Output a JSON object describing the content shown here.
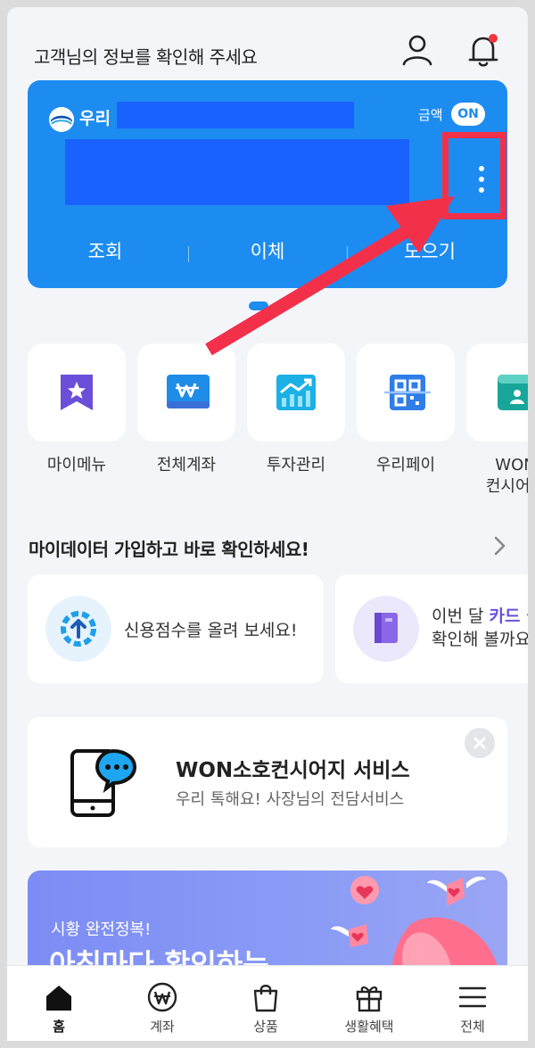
{
  "header": {
    "greeting": "고객님의 정보를 확인해 주세요"
  },
  "account_card": {
    "bank_name": "우리",
    "amount_label": "금액",
    "amount_toggle": "ON",
    "actions": [
      "조회",
      "이체",
      "모으기"
    ]
  },
  "quick_menu": [
    {
      "label": "마이메뉴",
      "icon": "star-bookmark-icon"
    },
    {
      "label": "전체계좌",
      "icon": "won-wallet-icon"
    },
    {
      "label": "투자관리",
      "icon": "chart-up-icon"
    },
    {
      "label": "우리페이",
      "icon": "qr-scan-icon"
    },
    {
      "label": "WON\n컨시어지",
      "icon": "concierge-card-icon"
    }
  ],
  "mydata": {
    "title": "마이데이터 가입하고 바로 확인하세요!",
    "cards": [
      {
        "text": "신용점수를 올려 보세요!"
      },
      {
        "line1_prefix": "이번 달 ",
        "line1_highlight": "카드 실",
        "line2": "확인해 볼까요"
      }
    ]
  },
  "promo": {
    "title": "WON소호컨시어지 서비스",
    "subtitle": "우리 톡해요! 사장님의 전담서비스"
  },
  "banner": {
    "subtitle": "시황 완전정복!",
    "title": "아침마다 확인하는"
  },
  "bottom_nav": [
    {
      "label": "홈",
      "icon": "home-icon",
      "active": true
    },
    {
      "label": "계좌",
      "icon": "won-circle-icon"
    },
    {
      "label": "상품",
      "icon": "shopping-bag-icon"
    },
    {
      "label": "생활혜택",
      "icon": "gift-icon"
    },
    {
      "label": "전체",
      "icon": "menu-icon"
    }
  ],
  "colors": {
    "primary": "#1d8cf0",
    "mask": "#1a62ff",
    "annotation": "#f2304a",
    "notification_dot": "#f0353d"
  }
}
